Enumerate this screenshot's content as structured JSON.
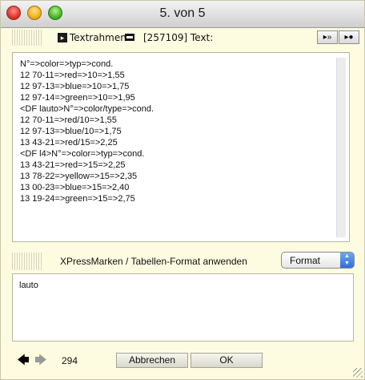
{
  "window": {
    "title": "5. von 5"
  },
  "header": {
    "label": "Textrahmen",
    "id_text": "[257109] Text:",
    "nav_next_label": "▸»",
    "nav_last_label": "▸●"
  },
  "content": {
    "lines": [
      "N°=>color=>typ=>cond.",
      "12 70-11=>red=>10=>1,55",
      "12 97-13=>blue=>10=>1,75",
      "12 97-14=>green=>10=>1,95",
      "<DF lauto>N°=>color/type=>cond.",
      "12 70-11=>red/10=>1,55",
      "12 97-13=>blue/10=>1,75",
      "13 43-21=>red/15=>2,25",
      "<DF l4>N°=>color=>typ=>cond.",
      "13 43-21=>red=>15=>2,25",
      "13 78-22=>yellow=>15=>2,35",
      "13 00-23=>blue=>15=>2,40",
      "13 19-24=>green=>15=>2,75"
    ]
  },
  "xpress": {
    "label": "XPressMarken / Tabellen-Format anwenden",
    "format_value": "Format"
  },
  "small_field": {
    "value": "lauto"
  },
  "bottom": {
    "count": "294",
    "cancel_label": "Abbrechen",
    "ok_label": "OK"
  }
}
